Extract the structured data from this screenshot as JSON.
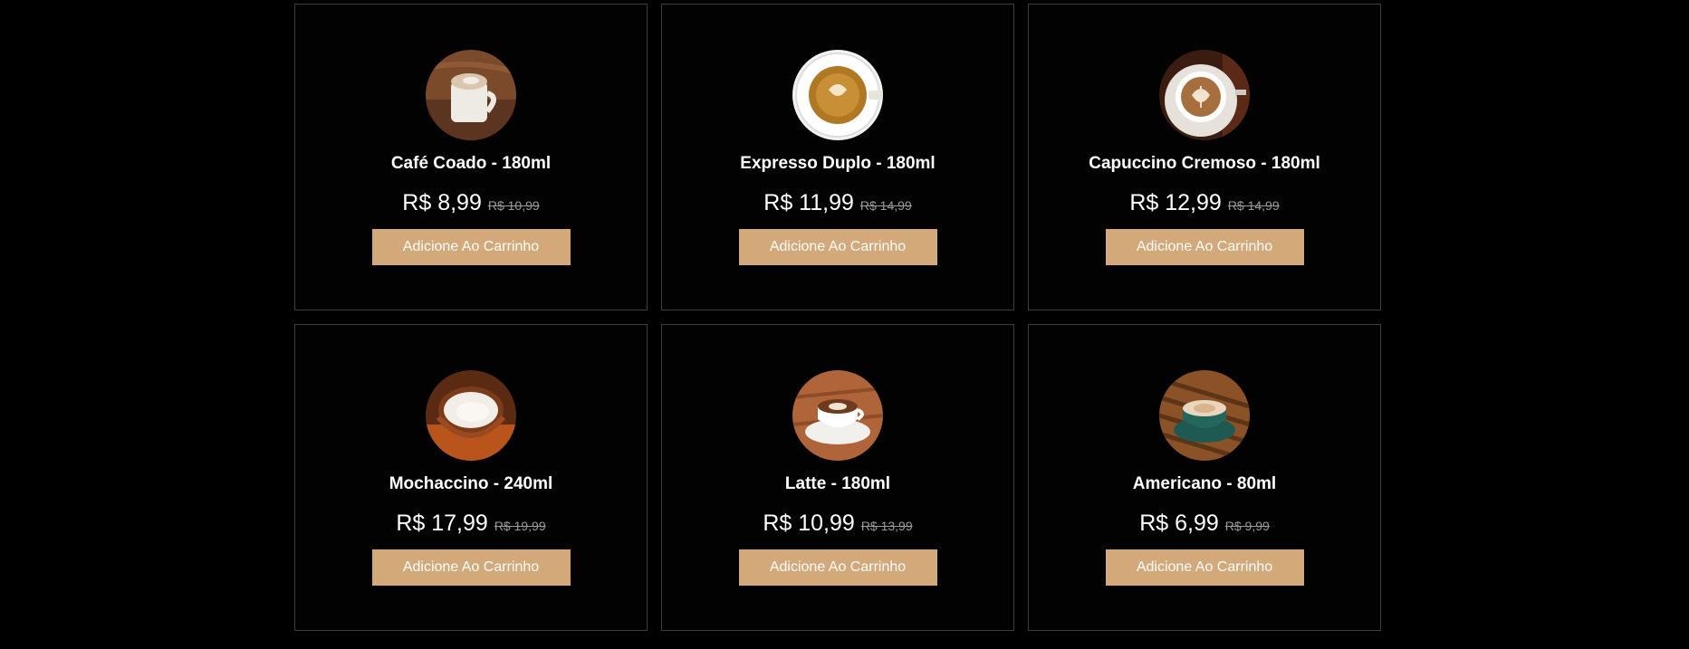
{
  "products": [
    {
      "name": "Café Coado - 180ml",
      "price": "R$ 8,99",
      "old_price": "R$ 10,99",
      "button": "Adicione Ao Carrinho",
      "image": "coffee-mug-latte-art"
    },
    {
      "name": "Expresso Duplo - 180ml",
      "price": "R$ 11,99",
      "old_price": "R$ 14,99",
      "button": "Adicione Ao Carrinho",
      "image": "espresso-cup-top-view"
    },
    {
      "name": "Capuccino Cremoso - 180ml",
      "price": "R$ 12,99",
      "old_price": "R$ 14,99",
      "button": "Adicione Ao Carrinho",
      "image": "cappuccino-latte-art"
    },
    {
      "name": "Mochaccino - 240ml",
      "price": "R$ 17,99",
      "old_price": "R$ 19,99",
      "button": "Adicione Ao Carrinho",
      "image": "mochaccino-glass-cup"
    },
    {
      "name": "Latte - 180ml",
      "price": "R$ 10,99",
      "old_price": "R$ 13,99",
      "button": "Adicione Ao Carrinho",
      "image": "latte-cup-saucer"
    },
    {
      "name": "Americano - 80ml",
      "price": "R$ 6,99",
      "old_price": "R$ 9,99",
      "button": "Adicione Ao Carrinho",
      "image": "americano-green-cup"
    }
  ],
  "colors": {
    "background": "#000000",
    "card_border": "#3d3d3d",
    "button": "#d3a97a",
    "text": "#ffffff",
    "old_price": "#9a9a9a"
  }
}
